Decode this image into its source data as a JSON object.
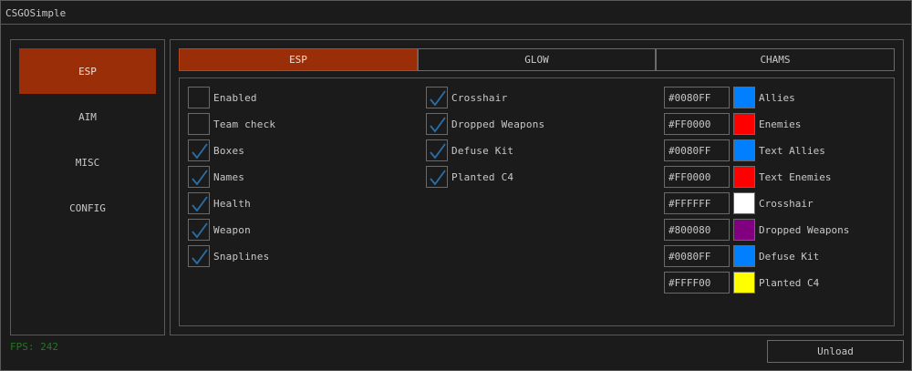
{
  "app": {
    "title": "CSGOSimple"
  },
  "sidebar": {
    "items": [
      {
        "label": "ESP",
        "active": true
      },
      {
        "label": "AIM",
        "active": false
      },
      {
        "label": "MISC",
        "active": false
      },
      {
        "label": "CONFIG",
        "active": false
      }
    ]
  },
  "tabs": [
    {
      "label": "ESP",
      "active": true
    },
    {
      "label": "GLOW",
      "active": false
    },
    {
      "label": "CHAMS",
      "active": false
    }
  ],
  "checkboxes_col1": [
    {
      "label": "Enabled",
      "checked": false
    },
    {
      "label": "Team check",
      "checked": false
    },
    {
      "label": "Boxes",
      "checked": true
    },
    {
      "label": "Names",
      "checked": true
    },
    {
      "label": "Health",
      "checked": true
    },
    {
      "label": "Weapon",
      "checked": true
    },
    {
      "label": "Snaplines",
      "checked": true
    }
  ],
  "checkboxes_col2": [
    {
      "label": "Crosshair",
      "checked": true
    },
    {
      "label": "Dropped Weapons",
      "checked": true
    },
    {
      "label": "Defuse Kit",
      "checked": true
    },
    {
      "label": "Planted C4",
      "checked": true
    }
  ],
  "colors": [
    {
      "hex": "#0080FF",
      "label": "Allies",
      "color": "#0080ff"
    },
    {
      "hex": "#FF0000",
      "label": "Enemies",
      "color": "#ff0000"
    },
    {
      "hex": "#0080FF",
      "label": "Text Allies",
      "color": "#0080ff"
    },
    {
      "hex": "#FF0000",
      "label": "Text Enemies",
      "color": "#ff0000"
    },
    {
      "hex": "#FFFFFF",
      "label": "Crosshair",
      "color": "#ffffff"
    },
    {
      "hex": "#800080",
      "label": "Dropped Weapons",
      "color": "#800080"
    },
    {
      "hex": "#0080FF",
      "label": "Defuse Kit",
      "color": "#0080ff"
    },
    {
      "hex": "#FFFF00",
      "label": "Planted C4",
      "color": "#ffff00"
    }
  ],
  "footer": {
    "fps": "FPS: 242",
    "unload_label": "Unload"
  },
  "theme": {
    "accent": "#9a2e08",
    "check": "#2a6fa8",
    "fps": "#1f7a1f"
  }
}
